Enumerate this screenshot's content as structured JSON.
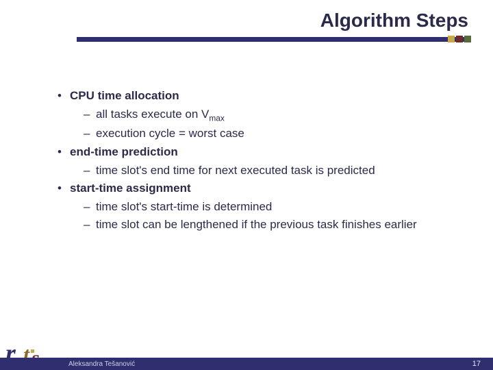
{
  "title": "Algorithm Steps",
  "bullets": {
    "b1": "CPU time allocation",
    "b1_1a": "all tasks execute on V",
    "b1_1_sub": "max",
    "b1_2": "execution cycle = worst case",
    "b2": "end-time prediction",
    "b2_1": "time slot's end time for next executed task is predicted",
    "b3": "start-time assignment",
    "b3_1": "time slot's start-time is determined",
    "b3_2": "time slot can be lengthened if the previous task finishes earlier"
  },
  "footer": {
    "author": "Aleksandra Tešanović",
    "page": "17"
  },
  "logo": {
    "r": "r",
    "t": "t",
    "s": "s"
  }
}
